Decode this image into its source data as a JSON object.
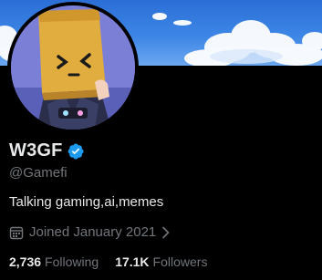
{
  "profile": {
    "display_name": "W3GF",
    "handle": "@Gamefi",
    "bio": "Talking gaming,ai,memes",
    "joined": "Joined January 2021",
    "verified_color": "#1d9bf0"
  },
  "stats": {
    "following_count": "2,736",
    "following_label": "Following",
    "followers_count": "17.1K",
    "followers_label": "Followers"
  },
  "icons": {
    "verified": "verified-badge-icon",
    "calendar": "calendar-icon",
    "chevron": "chevron-right-icon"
  },
  "colors": {
    "background": "#000000",
    "text_primary": "#e7e9ea",
    "text_secondary": "#71767b",
    "banner_sky": "#3d86e6"
  }
}
